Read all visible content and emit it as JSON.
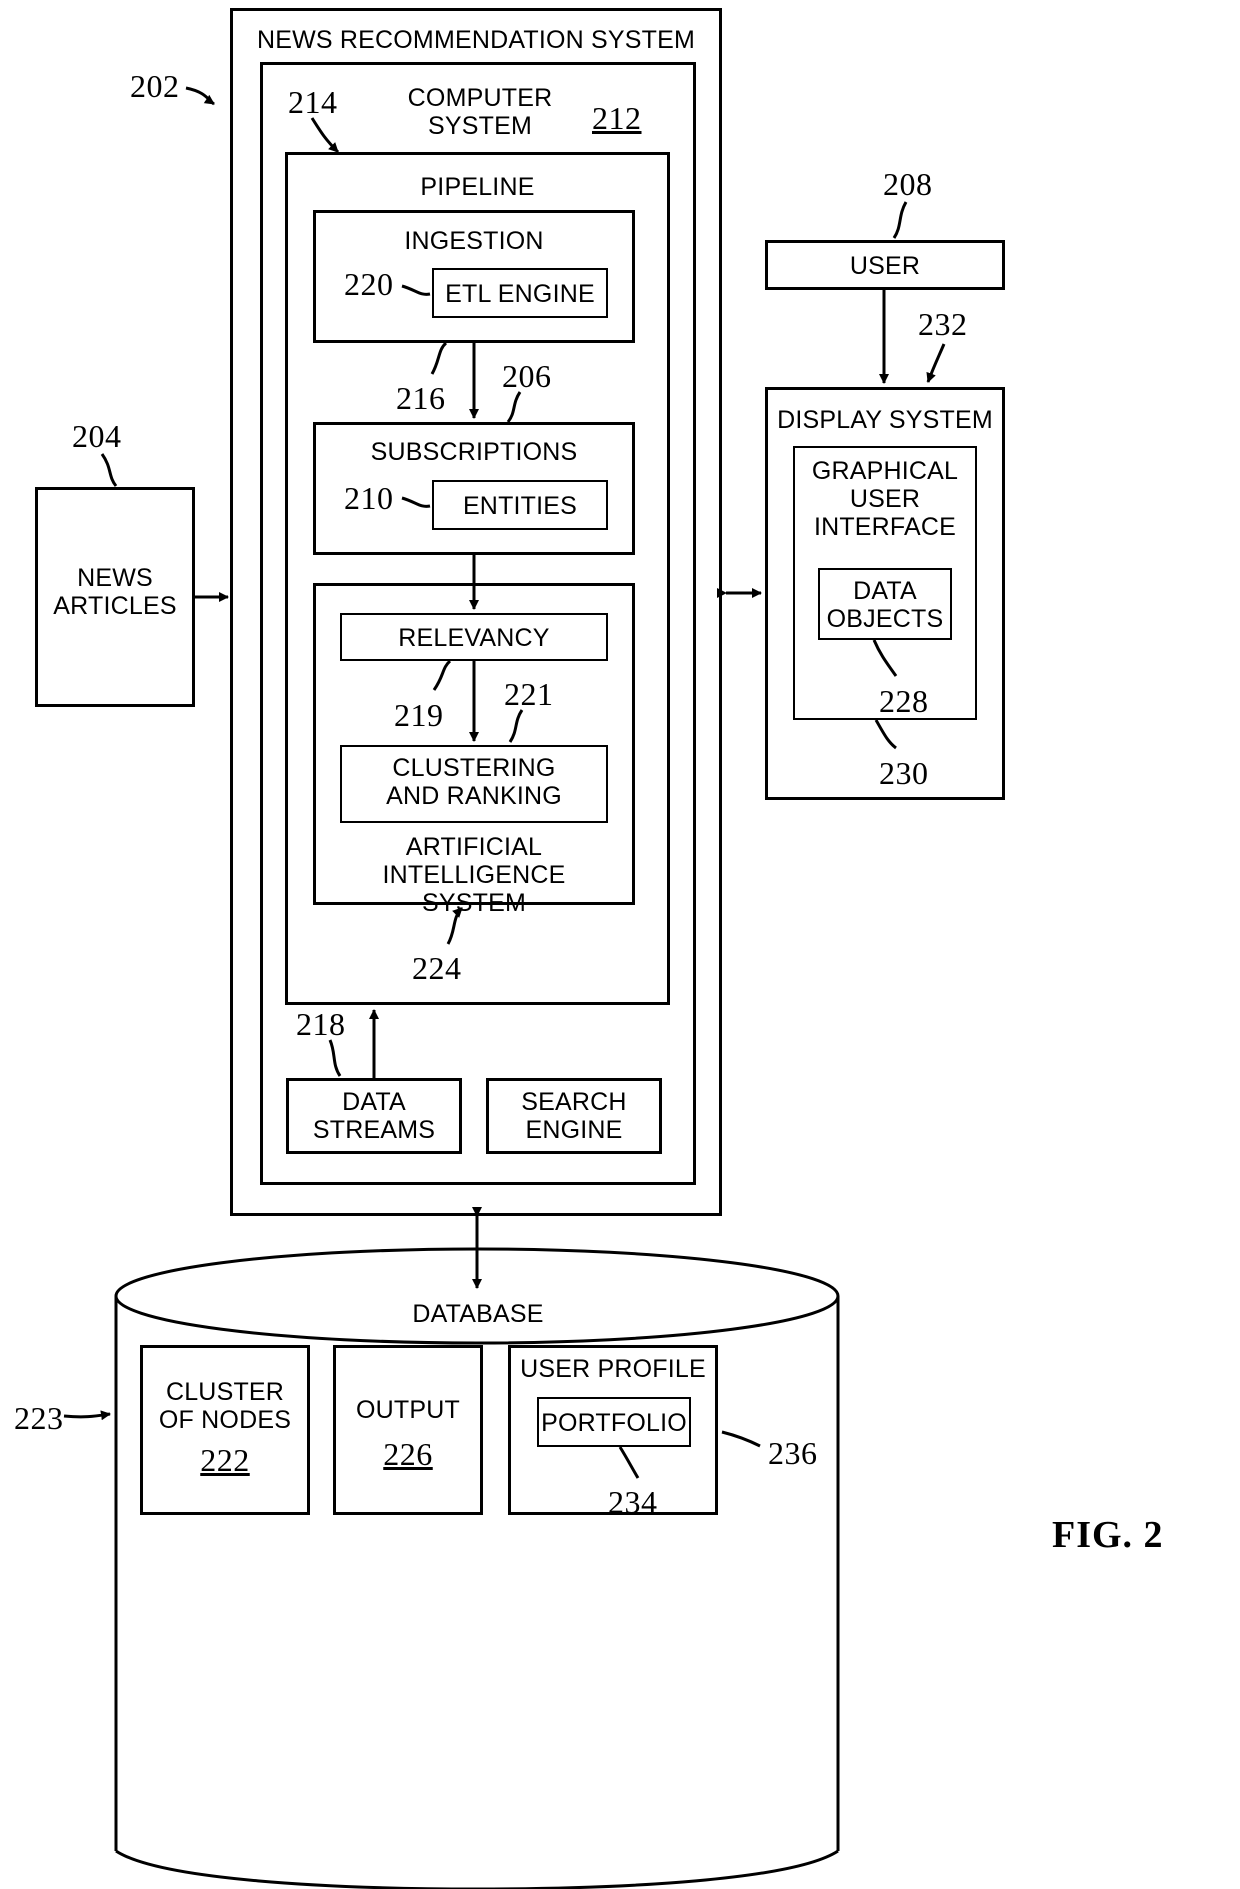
{
  "figure": {
    "label": "FIG. 2"
  },
  "blocks": {
    "news_recommendation_system": "NEWS RECOMMENDATION SYSTEM",
    "computer_system": "COMPUTER\nSYSTEM",
    "pipeline": "PIPELINE",
    "ingestion": "INGESTION",
    "etl_engine": "ETL ENGINE",
    "subscriptions": "SUBSCRIPTIONS",
    "entities": "ENTITIES",
    "relevancy": "RELEVANCY",
    "clustering_and_ranking": "CLUSTERING\nAND RANKING",
    "artificial_intelligence_system": "ARTIFICIAL INTELLIGENCE\nSYSTEM",
    "data_streams": "DATA\nSTREAMS",
    "search_engine": "SEARCH\nENGINE",
    "news_articles": "NEWS\nARTICLES",
    "user": "USER",
    "display_system": "DISPLAY SYSTEM",
    "graphical_user_interface": "GRAPHICAL\nUSER\nINTERFACE",
    "data_objects": "DATA\nOBJECTS",
    "database": "DATABASE",
    "cluster_of_nodes": "CLUSTER\nOF NODES",
    "output": "OUTPUT",
    "user_profile": "USER PROFILE",
    "portfolio": "PORTFOLIO"
  },
  "refs": {
    "r202": "202",
    "r204": "204",
    "r206": "206",
    "r208": "208",
    "r210": "210",
    "r212": "212",
    "r214": "214",
    "r216": "216",
    "r218": "218",
    "r219": "219",
    "r220": "220",
    "r221": "221",
    "r222": "222",
    "r223": "223",
    "r224": "224",
    "r226": "226",
    "r228": "228",
    "r230": "230",
    "r232": "232",
    "r234": "234",
    "r236": "236"
  },
  "colors": {
    "stroke": "#000000",
    "background": "#ffffff"
  }
}
